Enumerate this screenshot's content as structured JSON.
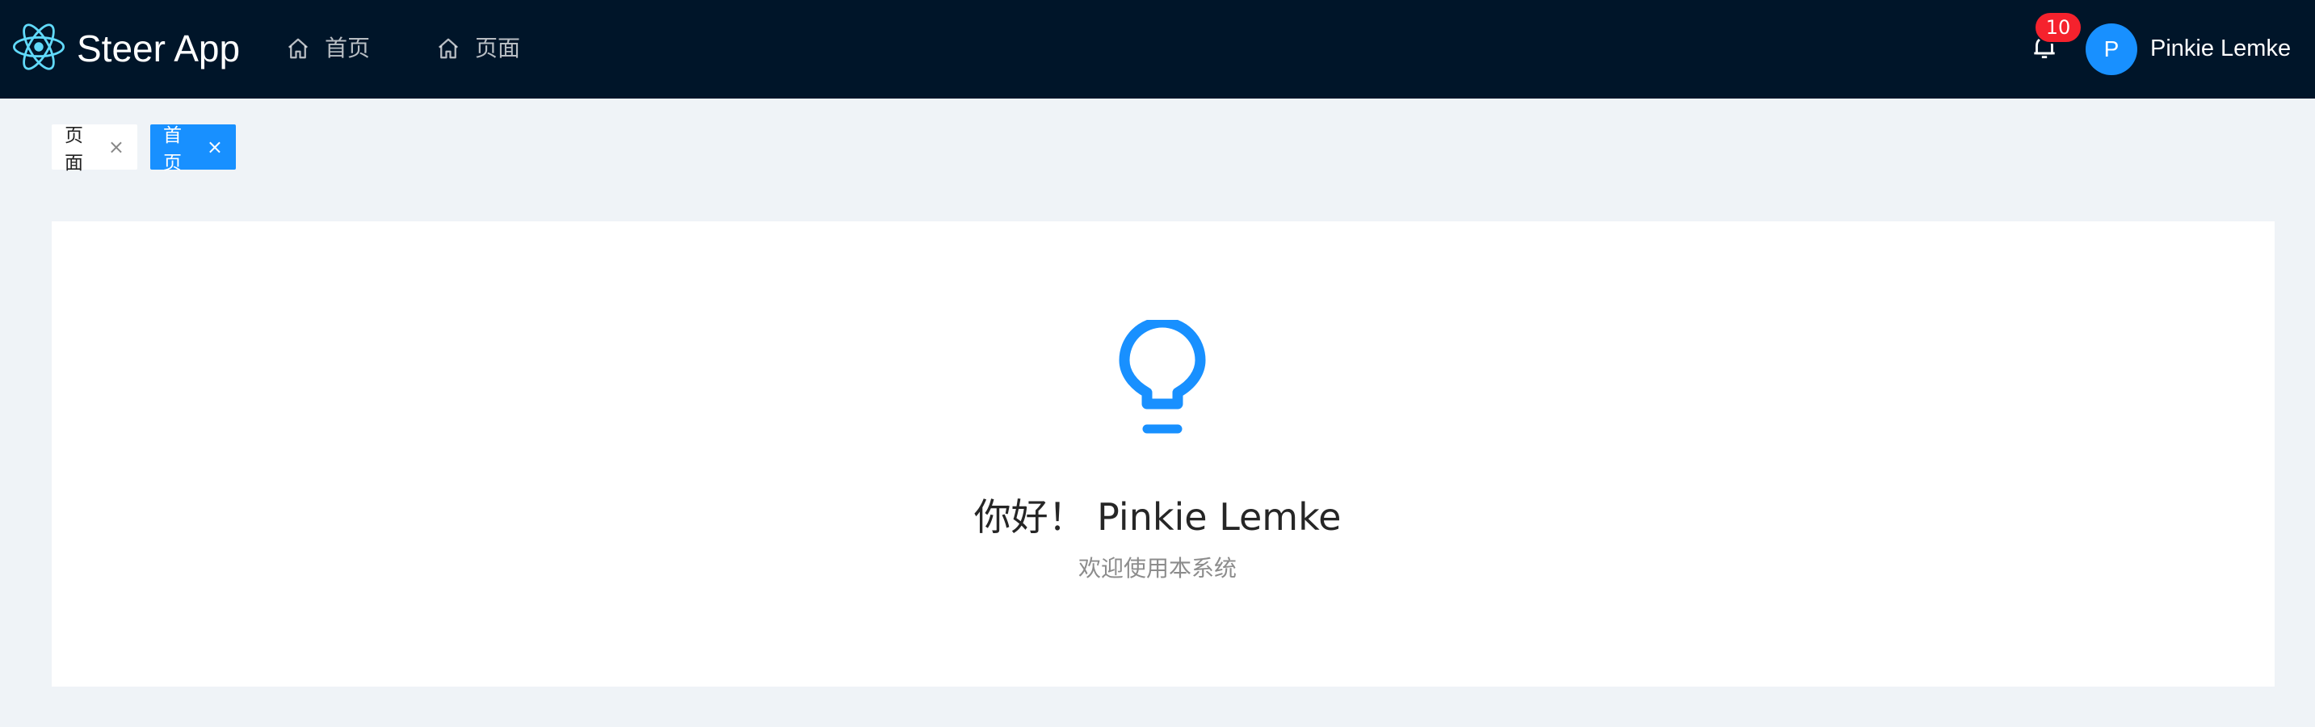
{
  "app": {
    "name": "Steer App"
  },
  "nav": {
    "items": [
      {
        "label": "首页",
        "icon": "home-icon"
      },
      {
        "label": "页面",
        "icon": "home-icon"
      }
    ]
  },
  "header": {
    "notifications_count": "10",
    "avatar_initial": "P",
    "username": "Pinkie Lemke"
  },
  "tabs": [
    {
      "label": "页面",
      "active": false,
      "close": "×"
    },
    {
      "label": "首页",
      "active": true,
      "close": "×"
    }
  ],
  "main": {
    "icon": "bulb-icon",
    "greeting": "你好！ Pinkie Lemke",
    "subtitle": "欢迎使用本系统"
  },
  "colors": {
    "header_bg": "#001529",
    "accent": "#1890ff",
    "badge": "#f5222d",
    "page_bg": "#eff3f7"
  }
}
